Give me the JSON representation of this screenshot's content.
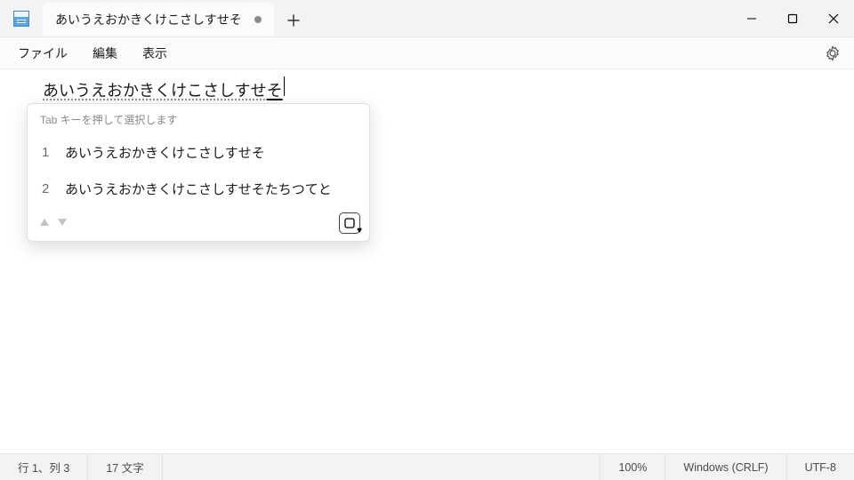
{
  "titlebar": {
    "app_icon_name": "notepad-icon",
    "tab": {
      "title": "あいうえおかきくけこさしすせそ",
      "modified": true
    }
  },
  "menu": {
    "items": [
      "ファイル",
      "編集",
      "表示"
    ]
  },
  "editor": {
    "pre_selection_text": "あいうえおかきくけこさしすせ",
    "selection_text": "そ"
  },
  "ime": {
    "hint": "Tab キーを押して選択します",
    "candidates": [
      {
        "num": "1",
        "text": "あいうえおかきくけこさしすせそ"
      },
      {
        "num": "2",
        "text": "あいうえおかきくけこさしすせそたちつてと"
      }
    ]
  },
  "status": {
    "pos": "行 1、列 3",
    "chars": "17 文字",
    "zoom": "100%",
    "eol": "Windows (CRLF)",
    "encoding": "UTF-8"
  }
}
